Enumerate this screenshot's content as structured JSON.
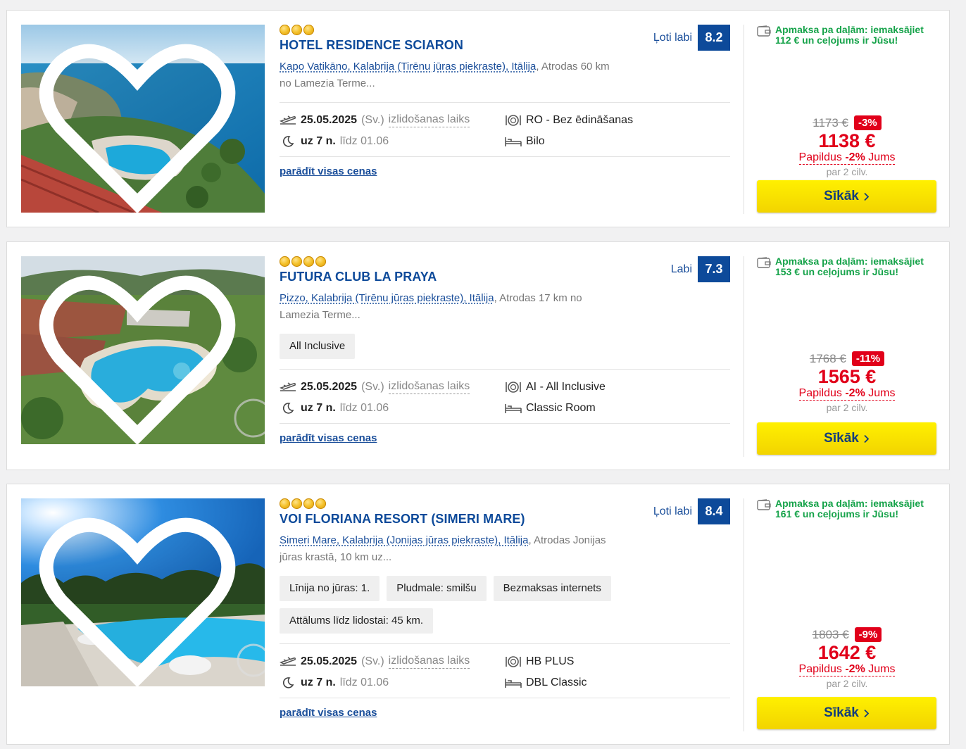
{
  "colors": {
    "brand_blue": "#0d4a9a",
    "price_red": "#e1001a",
    "green_note": "#16a34a",
    "button_yellow": "#f7e400"
  },
  "common": {
    "show_prices_label": "parādīt visas cenas",
    "details_button_label": "Sīkāk",
    "departure_label": "izlidošanas laiks",
    "departure_date": "25.05.2025",
    "departure_day": "(Sv.)",
    "duration": "uz 7 n.",
    "until": "līdz 01.06",
    "per_persons": "par 2 cilv.",
    "extra_prefix": "Papildus",
    "extra_discount": "-2%",
    "extra_suffix": "Jums"
  },
  "hotels": [
    {
      "stars": 3,
      "name": "Hotel Residence Sciaron",
      "location_link": "Kapo Vatikāno, Kalabrija (Tirēnu jūras piekraste), Itālija",
      "location_text": ", Atrodas 60 km no Lamezia Terme...",
      "rating_label": "Ļoti labi",
      "rating_score": "8.2",
      "tags": [],
      "board": "RO - Bez ēdināšanas",
      "room": "Bilo",
      "pay_note": "Apmaksa pa daļām: iemaksājiet 112 € un ceļojums ir Jūsu!",
      "old_price": "1173 €",
      "discount": "-3%",
      "price": "1138 €"
    },
    {
      "stars": 4,
      "name": "Futura Club La Praya",
      "location_link": "Pizzo, Kalabrija (Tirēnu jūras piekraste), Itālija",
      "location_text": ", Atrodas 17 km no Lamezia Terme...",
      "rating_label": "Labi",
      "rating_score": "7.3",
      "tags": [
        "All Inclusive"
      ],
      "board": "AI - All Inclusive",
      "room": "Classic Room",
      "pay_note": "Apmaksa pa daļām: iemaksājiet 153 € un ceļojums ir Jūsu!",
      "old_price": "1768 €",
      "discount": "-11%",
      "price": "1565 €"
    },
    {
      "stars": 4,
      "name": "VOI Floriana Resort (Simeri Mare)",
      "location_link": "Simeri Mare, Kalabrija (Jonijas jūras piekraste), Itālija",
      "location_text": ", Atrodas Jonijas jūras krastā, 10 km uz...",
      "rating_label": "Ļoti labi",
      "rating_score": "8.4",
      "tags": [
        "Līnija no jūras: 1.",
        "Pludmale: smilšu",
        "Bezmaksas internets",
        "Attālums līdz lidostai: 45 km."
      ],
      "board": "HB PLUS",
      "room": "DBL Classic",
      "pay_note": "Apmaksa pa daļām: iemaksājiet 161 € un ceļojums ir Jūsu!",
      "old_price": "1803 €",
      "discount": "-9%",
      "price": "1642 €"
    }
  ]
}
